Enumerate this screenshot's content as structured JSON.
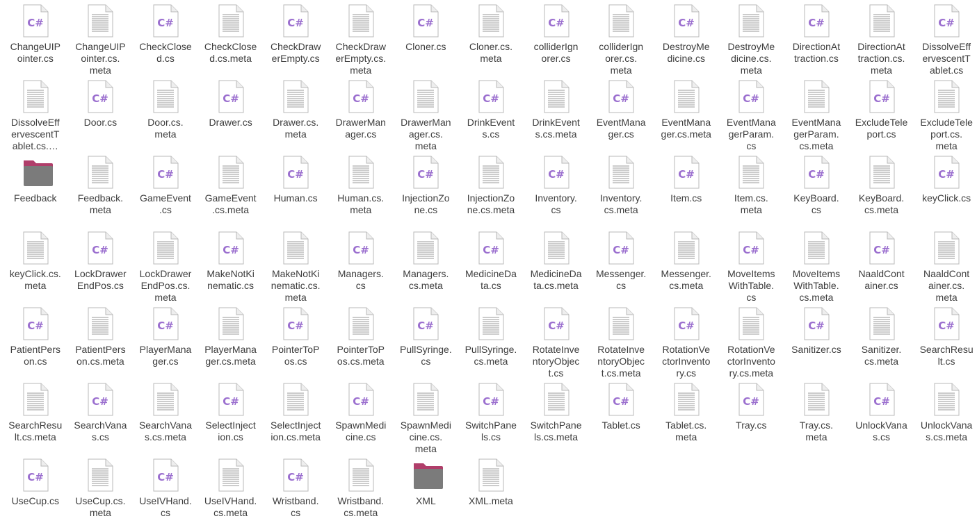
{
  "colors": {
    "csharp": "#9b6fcf",
    "folder_top": "#b03e6a",
    "folder_body": "#7b7b7b",
    "text_lines": "#9a9a9a"
  },
  "files": [
    {
      "name": "ChangeUIP\nointer.cs",
      "type": "cs"
    },
    {
      "name": "ChangeUIP\nointer.cs.\nmeta",
      "type": "meta"
    },
    {
      "name": "CheckClose\nd.cs",
      "type": "cs"
    },
    {
      "name": "CheckClose\nd.cs.meta",
      "type": "meta"
    },
    {
      "name": "CheckDraw\nerEmpty.cs",
      "type": "cs"
    },
    {
      "name": "CheckDraw\nerEmpty.cs.\nmeta",
      "type": "meta"
    },
    {
      "name": "Cloner.cs",
      "type": "cs"
    },
    {
      "name": "Cloner.cs.\nmeta",
      "type": "meta"
    },
    {
      "name": "colliderIgn\norer.cs",
      "type": "cs"
    },
    {
      "name": "colliderIgn\norer.cs.\nmeta",
      "type": "meta"
    },
    {
      "name": "DestroyMe\ndicine.cs",
      "type": "cs"
    },
    {
      "name": "DestroyMe\ndicine.cs.\nmeta",
      "type": "meta"
    },
    {
      "name": "DirectionAt\ntraction.cs",
      "type": "cs"
    },
    {
      "name": "DirectionAt\ntraction.cs.\nmeta",
      "type": "meta"
    },
    {
      "name": "DissolveEff\nervescentT\nablet.cs",
      "type": "cs"
    },
    {
      "name": "DissolveEff\nervescentT\nablet.cs.…",
      "type": "meta"
    },
    {
      "name": "Door.cs",
      "type": "cs"
    },
    {
      "name": "Door.cs.\nmeta",
      "type": "meta"
    },
    {
      "name": "Drawer.cs",
      "type": "cs"
    },
    {
      "name": "Drawer.cs.\nmeta",
      "type": "meta"
    },
    {
      "name": "DrawerMan\nager.cs",
      "type": "cs"
    },
    {
      "name": "DrawerMan\nager.cs.\nmeta",
      "type": "meta"
    },
    {
      "name": "DrinkEvent\ns.cs",
      "type": "cs"
    },
    {
      "name": "DrinkEvent\ns.cs.meta",
      "type": "meta"
    },
    {
      "name": "EventMana\nger.cs",
      "type": "cs"
    },
    {
      "name": "EventMana\nger.cs.meta",
      "type": "meta"
    },
    {
      "name": "EventMana\ngerParam.\ncs",
      "type": "cs"
    },
    {
      "name": "EventMana\ngerParam.\ncs.meta",
      "type": "meta"
    },
    {
      "name": "ExcludeTele\nport.cs",
      "type": "cs"
    },
    {
      "name": "ExcludeTele\nport.cs.\nmeta",
      "type": "meta"
    },
    {
      "name": "Feedback",
      "type": "folder"
    },
    {
      "name": "Feedback.\nmeta",
      "type": "meta"
    },
    {
      "name": "GameEvent\n.cs",
      "type": "cs"
    },
    {
      "name": "GameEvent\n.cs.meta",
      "type": "meta"
    },
    {
      "name": "Human.cs",
      "type": "cs"
    },
    {
      "name": "Human.cs.\nmeta",
      "type": "meta"
    },
    {
      "name": "InjectionZo\nne.cs",
      "type": "cs"
    },
    {
      "name": "InjectionZo\nne.cs.meta",
      "type": "meta"
    },
    {
      "name": "Inventory.\ncs",
      "type": "cs"
    },
    {
      "name": "Inventory.\ncs.meta",
      "type": "meta"
    },
    {
      "name": "Item.cs",
      "type": "cs"
    },
    {
      "name": "Item.cs.\nmeta",
      "type": "meta"
    },
    {
      "name": "KeyBoard.\ncs",
      "type": "cs"
    },
    {
      "name": "KeyBoard.\ncs.meta",
      "type": "meta"
    },
    {
      "name": "keyClick.cs",
      "type": "cs"
    },
    {
      "name": "keyClick.cs.\nmeta",
      "type": "meta"
    },
    {
      "name": "LockDrawer\nEndPos.cs",
      "type": "cs"
    },
    {
      "name": "LockDrawer\nEndPos.cs.\nmeta",
      "type": "meta"
    },
    {
      "name": "MakeNotKi\nnematic.cs",
      "type": "cs"
    },
    {
      "name": "MakeNotKi\nnematic.cs.\nmeta",
      "type": "meta"
    },
    {
      "name": "Managers.\ncs",
      "type": "cs"
    },
    {
      "name": "Managers.\ncs.meta",
      "type": "meta"
    },
    {
      "name": "MedicineDa\nta.cs",
      "type": "cs"
    },
    {
      "name": "MedicineDa\nta.cs.meta",
      "type": "meta"
    },
    {
      "name": "Messenger.\ncs",
      "type": "cs"
    },
    {
      "name": "Messenger.\ncs.meta",
      "type": "meta"
    },
    {
      "name": "MoveItems\nWithTable.\ncs",
      "type": "cs"
    },
    {
      "name": "MoveItems\nWithTable.\ncs.meta",
      "type": "meta"
    },
    {
      "name": "NaaldCont\nainer.cs",
      "type": "cs"
    },
    {
      "name": "NaaldCont\nainer.cs.\nmeta",
      "type": "meta"
    },
    {
      "name": "PatientPers\non.cs",
      "type": "cs"
    },
    {
      "name": "PatientPers\non.cs.meta",
      "type": "meta"
    },
    {
      "name": "PlayerMana\nger.cs",
      "type": "cs"
    },
    {
      "name": "PlayerMana\nger.cs.meta",
      "type": "meta"
    },
    {
      "name": "PointerToP\nos.cs",
      "type": "cs"
    },
    {
      "name": "PointerToP\nos.cs.meta",
      "type": "meta"
    },
    {
      "name": "PullSyringe.\ncs",
      "type": "cs"
    },
    {
      "name": "PullSyringe.\ncs.meta",
      "type": "meta"
    },
    {
      "name": "RotateInve\nntoryObjec\nt.cs",
      "type": "cs"
    },
    {
      "name": "RotateInve\nntoryObjec\nt.cs.meta",
      "type": "meta"
    },
    {
      "name": "RotationVe\nctorInvento\nry.cs",
      "type": "cs"
    },
    {
      "name": "RotationVe\nctorInvento\nry.cs.meta",
      "type": "meta"
    },
    {
      "name": "Sanitizer.cs",
      "type": "cs"
    },
    {
      "name": "Sanitizer.\ncs.meta",
      "type": "meta"
    },
    {
      "name": "SearchResu\nlt.cs",
      "type": "cs"
    },
    {
      "name": "SearchResu\nlt.cs.meta",
      "type": "meta"
    },
    {
      "name": "SearchVana\ns.cs",
      "type": "cs"
    },
    {
      "name": "SearchVana\ns.cs.meta",
      "type": "meta"
    },
    {
      "name": "SelectInject\nion.cs",
      "type": "cs"
    },
    {
      "name": "SelectInject\nion.cs.meta",
      "type": "meta"
    },
    {
      "name": "SpawnMedi\ncine.cs",
      "type": "cs"
    },
    {
      "name": "SpawnMedi\ncine.cs.\nmeta",
      "type": "meta"
    },
    {
      "name": "SwitchPane\nls.cs",
      "type": "cs"
    },
    {
      "name": "SwitchPane\nls.cs.meta",
      "type": "meta"
    },
    {
      "name": "Tablet.cs",
      "type": "cs"
    },
    {
      "name": "Tablet.cs.\nmeta",
      "type": "meta"
    },
    {
      "name": "Tray.cs",
      "type": "cs"
    },
    {
      "name": "Tray.cs.\nmeta",
      "type": "meta"
    },
    {
      "name": "UnlockVana\ns.cs",
      "type": "cs"
    },
    {
      "name": "UnlockVana\ns.cs.meta",
      "type": "meta"
    },
    {
      "name": "UseCup.cs",
      "type": "cs"
    },
    {
      "name": "UseCup.cs.\nmeta",
      "type": "meta"
    },
    {
      "name": "UseIVHand.\ncs",
      "type": "cs"
    },
    {
      "name": "UseIVHand.\ncs.meta",
      "type": "meta"
    },
    {
      "name": "Wristband.\ncs",
      "type": "cs"
    },
    {
      "name": "Wristband.\ncs.meta",
      "type": "meta"
    },
    {
      "name": "XML",
      "type": "folder"
    },
    {
      "name": "XML.meta",
      "type": "meta"
    }
  ]
}
